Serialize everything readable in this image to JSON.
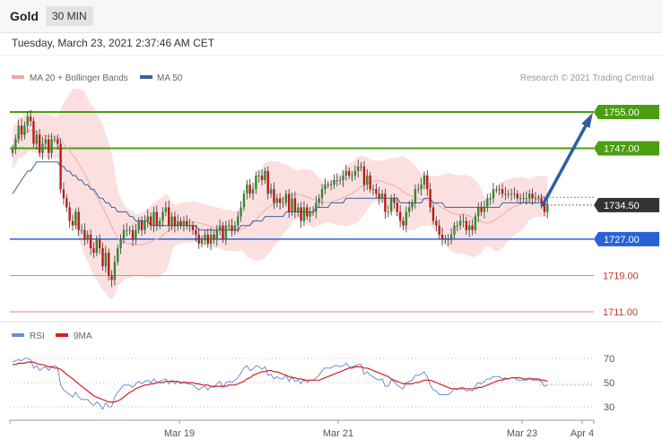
{
  "header": {
    "symbol": "Gold",
    "timeframe": "30 MIN",
    "datetime": "Tuesday, March 23, 2021 2:37:46 AM CET"
  },
  "legend": {
    "ma20": "MA 20 + Bollinger Bands",
    "ma50": "MA 50",
    "copyright": "Research © 2021 Trading Central",
    "rsi": "RSI",
    "rsi_ma": "9MA"
  },
  "colors": {
    "up_candle": "#2e8b2e",
    "down_candle": "#c01818",
    "bollinger_fill": "#fcdada",
    "ma20": "#f0a8a8",
    "ma50": "#3a5f9f",
    "resistance": "#4a9e0f",
    "support": "#2a62d6",
    "secondary_support": "#e0867a",
    "last_price": "#333333",
    "arrow": "#2c5f9f",
    "rsi": "#6b8fd4",
    "rsi_ma": "#d42020"
  },
  "chart_data": [
    {
      "type": "candlestick",
      "yscale": [
        1706,
        1765
      ],
      "levels": [
        {
          "value": 1755.0,
          "label": "1755.00",
          "kind": "resistance"
        },
        {
          "value": 1747.0,
          "label": "1747.00",
          "kind": "resistance"
        },
        {
          "value": 1734.5,
          "label": "1734.50",
          "kind": "last"
        },
        {
          "value": 1727.0,
          "label": "1727.00",
          "kind": "support"
        },
        {
          "value": 1719.0,
          "label": "1719.00",
          "kind": "secondary"
        },
        {
          "value": 1711.0,
          "label": "1711.00",
          "kind": "secondary"
        }
      ],
      "projection": {
        "from": 1734.5,
        "to": 1755.0
      },
      "x_ticks": [
        "Mar 19",
        "Mar 21",
        "Mar 23",
        "Apr 4"
      ],
      "close": [
        1747,
        1749,
        1752,
        1750,
        1752,
        1754,
        1753,
        1748,
        1750,
        1746,
        1748,
        1749,
        1746,
        1749,
        1749,
        1748,
        1738,
        1736,
        1734,
        1731,
        1730,
        1733,
        1729,
        1729,
        1727,
        1728,
        1725,
        1724,
        1727,
        1725,
        1721,
        1724,
        1719,
        1718,
        1722,
        1725,
        1727,
        1729,
        1729,
        1729,
        1727,
        1729,
        1731,
        1729,
        1731,
        1732,
        1730,
        1733,
        1730,
        1731,
        1733,
        1734,
        1730,
        1732,
        1730,
        1731,
        1730,
        1731,
        1730,
        1730,
        1729,
        1728,
        1726,
        1727,
        1728,
        1726,
        1728,
        1727,
        1729,
        1730,
        1727,
        1730,
        1730,
        1729,
        1730,
        1732,
        1734,
        1737,
        1739,
        1737,
        1738,
        1741,
        1741,
        1740,
        1742,
        1737,
        1738,
        1735,
        1736,
        1735,
        1735,
        1737,
        1733,
        1736,
        1733,
        1734,
        1731,
        1734,
        1732,
        1733,
        1733,
        1735,
        1736,
        1738,
        1739,
        1739,
        1739,
        1740,
        1740,
        1740,
        1741,
        1742,
        1741,
        1741,
        1742,
        1743,
        1743,
        1739,
        1741,
        1738,
        1738,
        1737,
        1736,
        1737,
        1733,
        1733,
        1736,
        1735,
        1733,
        1731,
        1730,
        1733,
        1734,
        1735,
        1738,
        1738,
        1739,
        1741,
        1738,
        1734,
        1731,
        1730,
        1728,
        1727,
        1727,
        1727,
        1728,
        1730,
        1730,
        1731,
        1731,
        1729,
        1730,
        1729,
        1732,
        1734,
        1733,
        1734,
        1736,
        1736,
        1738,
        1738,
        1738,
        1737,
        1737,
        1737,
        1737,
        1737,
        1736,
        1736,
        1736,
        1736,
        1737,
        1736,
        1736,
        1736,
        1735,
        1733,
        1734.5
      ],
      "ma50": [
        1737,
        1738,
        1739,
        1740,
        1741,
        1742,
        1742,
        1743,
        1744,
        1744,
        1744,
        1744,
        1744,
        1744,
        1744,
        1744,
        1743,
        1743,
        1742,
        1742,
        1741,
        1741,
        1740,
        1740,
        1739,
        1739,
        1738,
        1738,
        1737,
        1736,
        1736,
        1735,
        1735,
        1734,
        1734,
        1733,
        1733,
        1733,
        1733,
        1732,
        1732,
        1731,
        1731,
        1731,
        1731,
        1731,
        1730,
        1730,
        1730,
        1730,
        1730,
        1730,
        1730,
        1730,
        1730,
        1730,
        1730,
        1730,
        1730,
        1730,
        1730,
        1730,
        1729,
        1729,
        1729,
        1729,
        1729,
        1729,
        1729,
        1729,
        1729,
        1729,
        1729,
        1729,
        1729,
        1729,
        1730,
        1730,
        1730,
        1730,
        1731,
        1731,
        1731,
        1731,
        1732,
        1732,
        1732,
        1732,
        1732,
        1732,
        1732,
        1733,
        1733,
        1733,
        1733,
        1733,
        1733,
        1733,
        1733,
        1733,
        1733,
        1734,
        1734,
        1734,
        1734,
        1734,
        1735,
        1735,
        1735,
        1735,
        1735,
        1736,
        1736,
        1736,
        1736,
        1736,
        1736,
        1736,
        1736,
        1736,
        1736,
        1736,
        1736,
        1736,
        1736,
        1736,
        1736,
        1736,
        1736,
        1735,
        1735,
        1735,
        1735,
        1735,
        1735,
        1735,
        1735,
        1736,
        1736,
        1736,
        1735,
        1735,
        1735,
        1735,
        1734,
        1734,
        1734,
        1734,
        1734,
        1734,
        1734,
        1734,
        1734,
        1734,
        1734,
        1734,
        1734,
        1734,
        1734,
        1734,
        1734,
        1734,
        1734,
        1735,
        1735,
        1735,
        1735,
        1735,
        1735,
        1735,
        1735,
        1735,
        1735,
        1735,
        1735,
        1735,
        1735,
        1735,
        1734.5
      ]
    },
    {
      "type": "line",
      "name": "RSI",
      "yscale": [
        20,
        80
      ],
      "ticks": [
        70,
        50,
        30
      ],
      "rsi": [
        67,
        68,
        69,
        68,
        70,
        70,
        69,
        62,
        64,
        60,
        62,
        63,
        60,
        63,
        64,
        62,
        48,
        44,
        42,
        40,
        38,
        42,
        38,
        36,
        36,
        36,
        33,
        31,
        34,
        32,
        28,
        33,
        30,
        30,
        38,
        42,
        45,
        48,
        48,
        48,
        46,
        49,
        51,
        49,
        51,
        52,
        50,
        53,
        50,
        51,
        52,
        53,
        49,
        52,
        49,
        51,
        49,
        51,
        49,
        49,
        48,
        46,
        44,
        46,
        47,
        44,
        47,
        46,
        49,
        51,
        46,
        50,
        51,
        50,
        52,
        54,
        58,
        62,
        64,
        60,
        61,
        64,
        63,
        61,
        63,
        56,
        57,
        53,
        55,
        53,
        53,
        56,
        51,
        55,
        51,
        52,
        49,
        53,
        50,
        52,
        52,
        54,
        56,
        60,
        62,
        62,
        62,
        64,
        64,
        63,
        64,
        66,
        63,
        63,
        64,
        65,
        65,
        57,
        59,
        56,
        55,
        53,
        52,
        53,
        47,
        47,
        52,
        51,
        48,
        46,
        45,
        50,
        51,
        52,
        56,
        56,
        57,
        59,
        55,
        48,
        44,
        43,
        40,
        40,
        40,
        40,
        42,
        45,
        44,
        46,
        46,
        43,
        44,
        43,
        47,
        50,
        49,
        51,
        53,
        53,
        55,
        55,
        55,
        53,
        54,
        53,
        54,
        54,
        52,
        52,
        52,
        52,
        54,
        52,
        52,
        52,
        51,
        47,
        48
      ],
      "rsi_ma": [
        65,
        65,
        66,
        66,
        66,
        67,
        67,
        67,
        66,
        65,
        65,
        64,
        63,
        63,
        62,
        62,
        61,
        59,
        57,
        55,
        53,
        51,
        49,
        47,
        45,
        43,
        41,
        39,
        38,
        37,
        36,
        35,
        34,
        34,
        34,
        35,
        36,
        38,
        40,
        42,
        43,
        45,
        46,
        47,
        48,
        48,
        49,
        49,
        50,
        50,
        50,
        51,
        51,
        51,
        51,
        51,
        50,
        50,
        50,
        50,
        50,
        49,
        49,
        48,
        48,
        48,
        47,
        47,
        47,
        47,
        47,
        47,
        48,
        48,
        48,
        49,
        50,
        51,
        53,
        54,
        56,
        57,
        58,
        59,
        59,
        60,
        60,
        59,
        59,
        58,
        57,
        56,
        55,
        54,
        54,
        53,
        53,
        52,
        52,
        52,
        52,
        52,
        52,
        53,
        54,
        55,
        56,
        57,
        58,
        59,
        60,
        61,
        62,
        62,
        63,
        63,
        63,
        62,
        62,
        61,
        60,
        59,
        58,
        57,
        56,
        55,
        53,
        52,
        51,
        50,
        49,
        49,
        49,
        49,
        50,
        50,
        51,
        52,
        52,
        52,
        51,
        50,
        49,
        48,
        47,
        46,
        45,
        45,
        45,
        45,
        45,
        45,
        45,
        45,
        45,
        46,
        46,
        47,
        48,
        49,
        50,
        51,
        52,
        52,
        53,
        53,
        54,
        54,
        54,
        54,
        53,
        53,
        53,
        53,
        53,
        53,
        52,
        52,
        51
      ]
    }
  ]
}
